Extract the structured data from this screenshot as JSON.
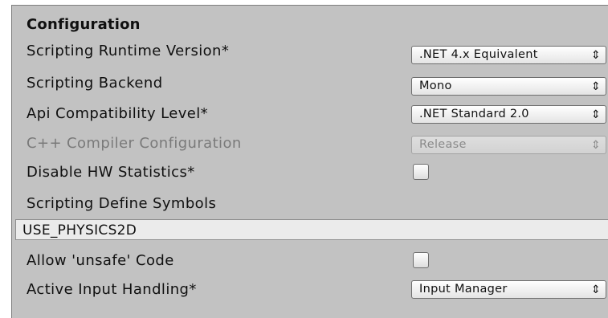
{
  "section": {
    "title": "Configuration"
  },
  "rows": {
    "scripting_runtime_version": {
      "label": "Scripting Runtime Version*",
      "value": ".NET 4.x Equivalent"
    },
    "scripting_backend": {
      "label": "Scripting Backend",
      "value": "Mono"
    },
    "api_compatibility_level": {
      "label": "Api Compatibility Level*",
      "value": ".NET Standard 2.0"
    },
    "cpp_compiler_configuration": {
      "label": "C++ Compiler Configuration",
      "value": "Release",
      "enabled": false
    },
    "disable_hw_statistics": {
      "label": "Disable HW Statistics*",
      "checked": false
    },
    "scripting_define_symbols": {
      "label": "Scripting Define Symbols",
      "value": "USE_PHYSICS2D"
    },
    "allow_unsafe_code": {
      "label": "Allow 'unsafe' Code",
      "checked": false
    },
    "active_input_handling": {
      "label": "Active Input Handling*",
      "value": "Input Manager"
    }
  },
  "icons": {
    "popup_arrows": "⇕"
  },
  "colors": {
    "panel_bg": "#c2c2c2",
    "disabled_text": "#7a7a7a",
    "textfield_bg": "#ebebeb"
  }
}
